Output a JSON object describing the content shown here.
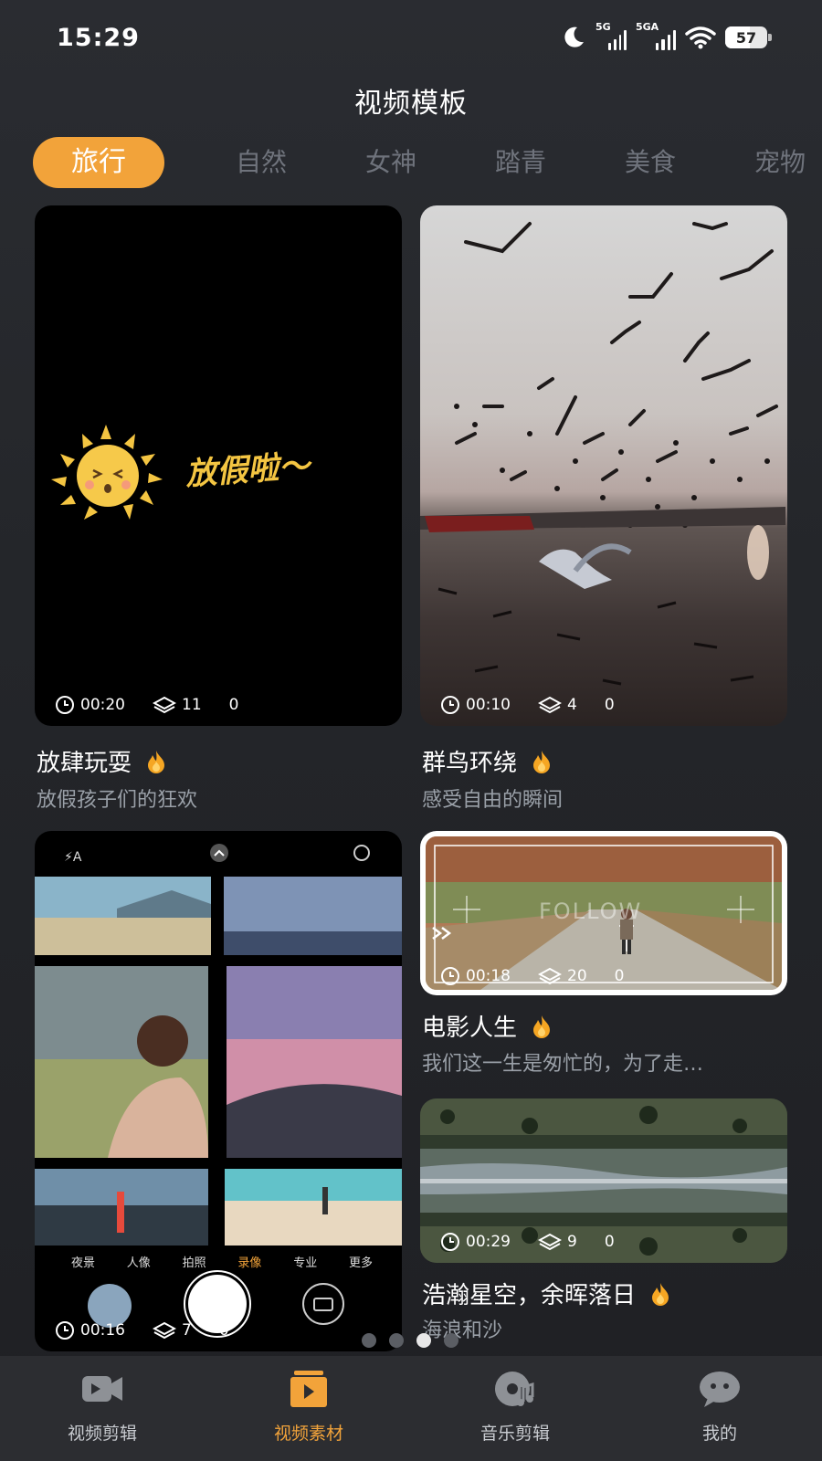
{
  "status_bar": {
    "time": "15:29",
    "net1": "5G",
    "net2": "5GA",
    "battery": "57"
  },
  "page_title": "视频模板",
  "tabs": [
    {
      "label": "旅行",
      "active": true
    },
    {
      "label": "自然",
      "active": false
    },
    {
      "label": "女神",
      "active": false
    },
    {
      "label": "踏青",
      "active": false
    },
    {
      "label": "美食",
      "active": false
    },
    {
      "label": "宠物",
      "active": false
    }
  ],
  "cards": [
    {
      "thumb_text": "放假啦～",
      "duration": "00:20",
      "layers": "11",
      "count": "0",
      "title": "放肆玩耍",
      "desc": "放假孩子们的狂欢"
    },
    {
      "duration": "00:10",
      "layers": "4",
      "count": "0",
      "title": "群鸟环绕",
      "desc": "感受自由的瞬间"
    },
    {
      "duration": "00:16",
      "layers": "7",
      "count": "0",
      "camera_modes": [
        "夜景",
        "人像",
        "拍照",
        "录像",
        "专业",
        "更多"
      ],
      "active_mode": "录像"
    },
    {
      "thumb_text": "FOLLOW",
      "duration": "00:18",
      "layers": "20",
      "count": "0",
      "title": "电影人生",
      "desc": "我们这一生是匆忙的，为了走…"
    },
    {
      "duration": "00:29",
      "layers": "9",
      "count": "0",
      "title": "浩瀚星空，余晖落日",
      "desc": "海浪和沙"
    }
  ],
  "pager": {
    "total": 4,
    "active_index": 2
  },
  "bottom_nav": [
    {
      "label": "视频剪辑",
      "icon": "video-camera-icon",
      "active": false
    },
    {
      "label": "视频素材",
      "icon": "video-material-icon",
      "active": true
    },
    {
      "label": "音乐剪辑",
      "icon": "music-disc-icon",
      "active": false
    },
    {
      "label": "我的",
      "icon": "chat-face-icon",
      "active": false
    }
  ],
  "colors": {
    "accent": "#f2a33a",
    "background": "#26282c",
    "nav_bg": "#2c2d31"
  }
}
